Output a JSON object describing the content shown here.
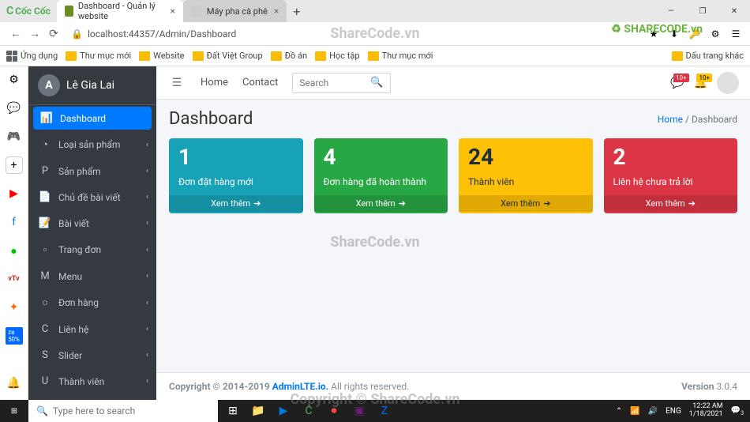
{
  "browser": {
    "name": "Cốc Cốc",
    "tabs": [
      {
        "title": "Dashboard - Quản lý website",
        "icon": "adminlte"
      },
      {
        "title": "Máy pha cà phê",
        "icon": "page"
      }
    ],
    "url": "localhost:44357/Admin/Dashboard",
    "bookmarks": [
      "Ứng dụng",
      "Thư mục mới",
      "Website",
      "Đất Việt Group",
      "Đồ án",
      "Học tập",
      "Thư mục mới"
    ],
    "bookmarks_right": "Dấu trang khác"
  },
  "watermark": "ShareCode.vn",
  "sharecode_brand": "SHARECODE.vn",
  "sidebar": {
    "brand": "Lê Gia Lai",
    "brand_icon": "A",
    "items": [
      {
        "icon": "tachometer",
        "label": "Dashboard",
        "active": true,
        "expandable": false
      },
      {
        "icon": "circle-notch",
        "label": "Loại sản phẩm",
        "expandable": true
      },
      {
        "icon": "parking",
        "label": "Sản phẩm",
        "expandable": true
      },
      {
        "icon": "file-alt",
        "label": "Chủ đề bài viết",
        "expandable": true
      },
      {
        "icon": "file",
        "label": "Bài viết",
        "expandable": true
      },
      {
        "icon": "page",
        "label": "Trang đơn",
        "expandable": true
      },
      {
        "icon": "bars",
        "label": "Menu",
        "expandable": true
      },
      {
        "icon": "shopping",
        "label": "Đơn hàng",
        "expandable": true
      },
      {
        "icon": "phone",
        "label": "Liên hệ",
        "expandable": true
      },
      {
        "icon": "sliders",
        "label": "Slider",
        "expandable": true
      },
      {
        "icon": "user",
        "label": "Thành viên",
        "expandable": true
      }
    ]
  },
  "navbar": {
    "links": [
      "Home",
      "Contact"
    ],
    "search_placeholder": "Search",
    "msg_badge": "10+",
    "bell_badge": "10+"
  },
  "page": {
    "title": "Dashboard",
    "breadcrumb_home": "Home",
    "breadcrumb_current": "Dashboard"
  },
  "cards": [
    {
      "value": "1",
      "label": "Đơn đặt hàng mới",
      "link": "Xem thêm",
      "color": "c-blue"
    },
    {
      "value": "4",
      "label": "Đơn hàng đã hoàn thành",
      "link": "Xem thêm",
      "color": "c-green"
    },
    {
      "value": "24",
      "label": "Thành viên",
      "link": "Xem thêm",
      "color": "c-yellow"
    },
    {
      "value": "2",
      "label": "Liên hệ chưa trả lời",
      "link": "Xem thêm",
      "color": "c-red"
    }
  ],
  "footer": {
    "copyright": "Copyright © 2014-2019",
    "brand": "AdminLTE.io.",
    "rights": "All rights reserved.",
    "version_label": "Version",
    "version": "3.0.4"
  },
  "taskbar": {
    "search": "Type here to search",
    "lang": "ENG",
    "time": "12:22 AM",
    "date": "1/18/2021",
    "notif": "3"
  }
}
